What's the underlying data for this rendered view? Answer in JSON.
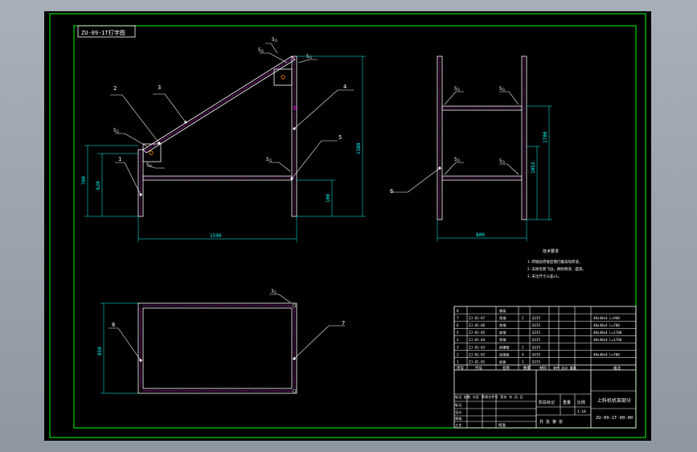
{
  "drawing": {
    "title_tag": "ZU-09-1T打字图",
    "colors": {
      "background": "#000000",
      "frame": "#00ff00",
      "outline": "#ffffff",
      "weld": "#ff00ff",
      "dimension": "#00ffff",
      "hatch": "#ff0000",
      "leader": "#ffffff",
      "text": "#ffffff",
      "point": "#ff8800"
    },
    "side_view": {
      "callouts": [
        "2",
        "3",
        "4",
        "5",
        "1"
      ],
      "welds": [
        "5△",
        "5△",
        "5△",
        "5△",
        "5△"
      ],
      "dims": {
        "height_700": "700",
        "height_620": "620",
        "height_1380": "1380",
        "height_100": "100",
        "width_1590": "1590"
      }
    },
    "front_view": {
      "callouts": [
        "6"
      ],
      "welds": [
        "5△",
        "5△",
        "5△",
        "5△"
      ],
      "dims": {
        "height_1700": "1700",
        "height_1053": "1053",
        "width_800": "800"
      }
    },
    "top_view": {
      "callouts": [
        "8",
        "7"
      ],
      "welds": [
        "3△"
      ],
      "dims": {
        "height_850": "850"
      }
    },
    "tech_notes": {
      "title": "技术要求",
      "lines": [
        "1.焊缝处焊接后需打磨去除焊渣，",
        "2.去除毛刺飞边，刷防锈漆，面漆。",
        "3.未注尺寸公差±1。"
      ]
    },
    "bom": {
      "rows": [
        {
          "no": "8",
          "code": "",
          "name": "横梁",
          "qty": "",
          "mat": "",
          "spec": ""
        },
        {
          "no": "7",
          "code": "ZJ-01-07",
          "name": "角钢",
          "qty": "2",
          "mat": "Q235",
          "spec": "40x40x4 L=940"
        },
        {
          "no": "6",
          "code": "ZJ-01-06",
          "name": "角钢",
          "qty": "",
          "mat": "Q235",
          "spec": "40x40x4 L=700"
        },
        {
          "no": "5",
          "code": "ZJ-01-05",
          "name": "扁钢",
          "qty": "",
          "mat": "Q235",
          "spec": "40x40x4 L=1700"
        },
        {
          "no": "4",
          "code": "ZJ-01-04",
          "name": "角钢",
          "qty": "",
          "mat": "Q235",
          "spec": "40x40x4 L=1700"
        },
        {
          "no": "3",
          "code": "ZJ-01-03",
          "name": "斜撑管",
          "qty": "2",
          "mat": "Q235",
          "spec": ""
        },
        {
          "no": "2",
          "code": "ZJ-01-02",
          "name": "连接板",
          "qty": "4",
          "mat": "Q235",
          "spec": "40x40x4 L=700"
        },
        {
          "no": "1",
          "code": "ZJ-01-01",
          "name": "底板",
          "qty": "1",
          "mat": "Q235",
          "spec": ""
        }
      ],
      "header": {
        "no": "序号",
        "code": "代号",
        "name": "名称",
        "qty": "数量",
        "mat": "材料",
        "weight": "单件 总计 重量",
        "remark": "备注"
      }
    },
    "title_block": {
      "left_rows": [
        "标记",
        "设计",
        "审核",
        "工艺"
      ],
      "revision": "标记 处数 分区 更改文件号 签名 年.月.日",
      "approve": "批准",
      "stage_label": "阶段标记",
      "weight_label": "重量",
      "scale_label": "比例",
      "scale_value": "1:10",
      "sheets": "共  张 第  张",
      "product_name": "上料机机架部分",
      "drawing_no": "ZU-09-1T-00-00"
    }
  }
}
